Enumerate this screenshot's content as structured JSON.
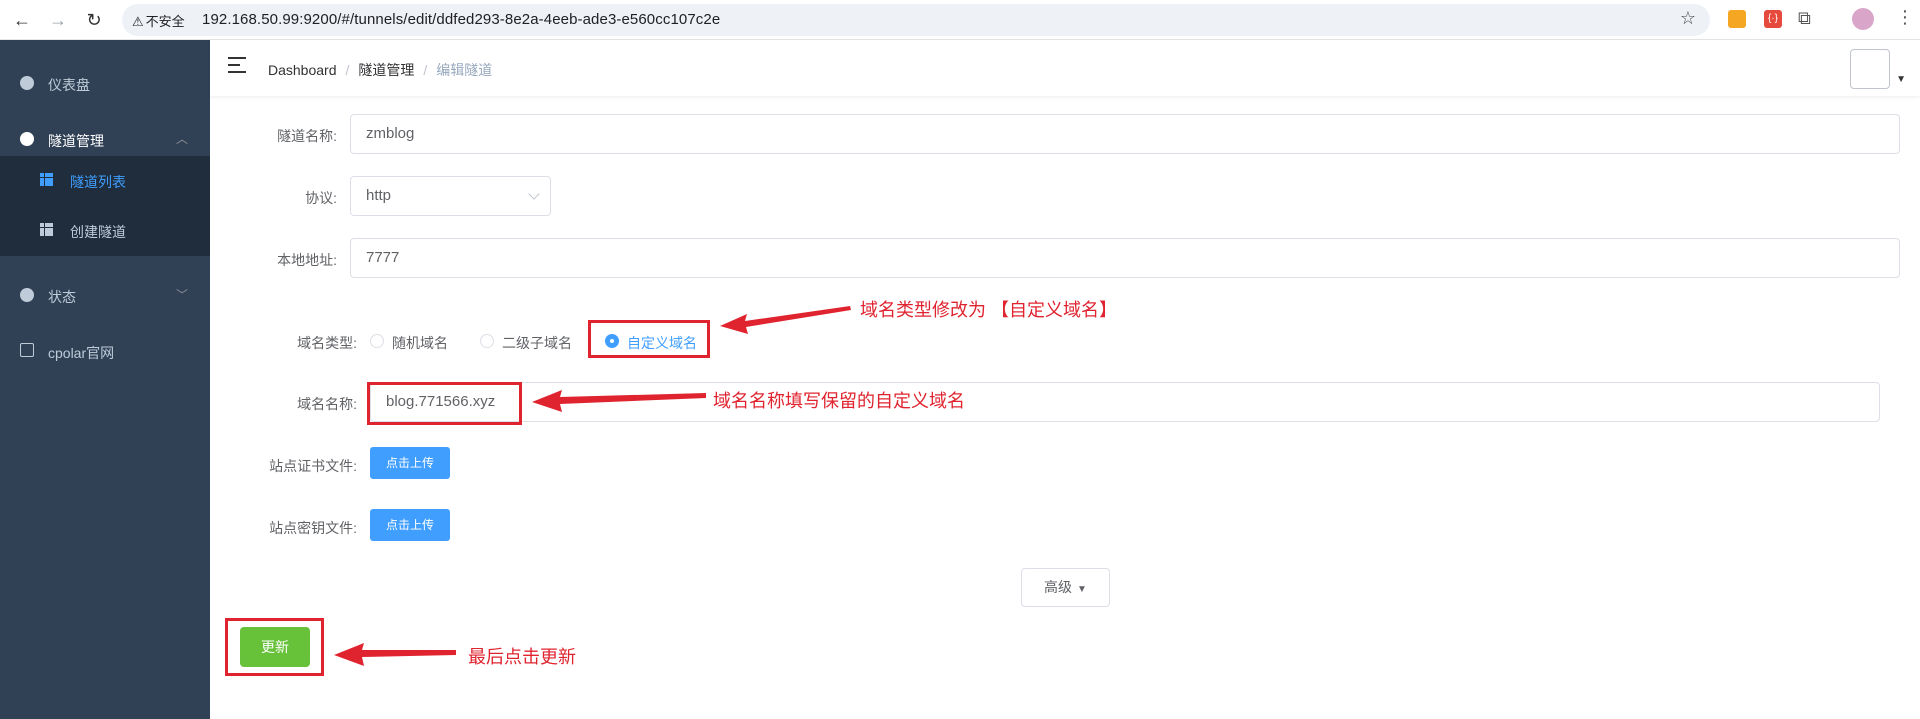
{
  "browser": {
    "security_label": "不安全",
    "url": "192.168.50.99:9200/#/tunnels/edit/ddfed293-8e2a-4eeb-ade3-e560cc107c2e"
  },
  "sidebar": {
    "items": [
      {
        "label": "仪表盘"
      },
      {
        "label": "隧道管理"
      },
      {
        "label": "状态"
      },
      {
        "label": "cpolar官网"
      }
    ],
    "subitems": [
      {
        "label": "隧道列表"
      },
      {
        "label": "创建隧道"
      }
    ],
    "active_color": "#409eff",
    "bg_color": "#304156"
  },
  "header": {
    "breadcrumb": [
      "Dashboard",
      "隧道管理",
      "编辑隧道"
    ]
  },
  "form": {
    "tunnel_name": {
      "label": "隧道名称:",
      "value": "zmblog"
    },
    "protocol": {
      "label": "协议:",
      "value": "http"
    },
    "local_address": {
      "label": "本地地址:",
      "value": "7777"
    },
    "domain_type": {
      "label": "域名类型:",
      "options": [
        "随机域名",
        "二级子域名",
        "自定义域名"
      ],
      "selected": "自定义域名"
    },
    "domain_name": {
      "label": "域名名称:",
      "value": "blog.771566.xyz"
    },
    "cert_file": {
      "label": "站点证书文件:",
      "button": "点击上传"
    },
    "key_file": {
      "label": "站点密钥文件:",
      "button": "点击上传"
    },
    "advanced_label": "高级",
    "update_label": "更新"
  },
  "annotations": {
    "domain_type_note": "域名类型修改为 【自定义域名】",
    "domain_name_note": "域名名称填写保留的自定义域名",
    "update_note": "最后点击更新",
    "color": "#e0242f"
  }
}
